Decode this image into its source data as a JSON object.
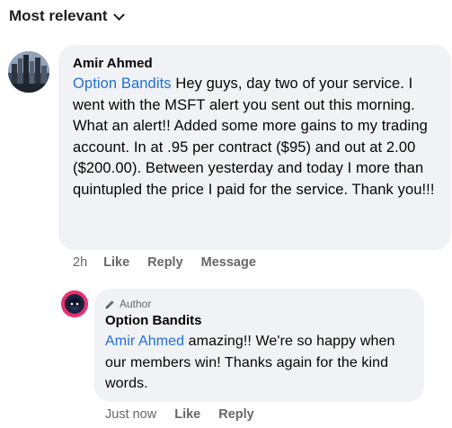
{
  "sort": {
    "label": "Most relevant",
    "icon": "chevron-down-icon"
  },
  "comments": [
    {
      "author": "Amir Ahmed",
      "mention": "Option Bandits",
      "text": " Hey guys, day two of your service.  I went with the MSFT alert you sent out this morning.  What an alert!! Added some more gains to my trading account.  In at .95 per contract ($95) and out at 2.00 ($200.00).  Between yesterday and today I more than quintupled the price I paid for the service. Thank you!!!",
      "time": "2h",
      "actions": [
        "Like",
        "Reply",
        "Message"
      ]
    },
    {
      "badge": "Author",
      "badge_icon": "pencil-icon",
      "author": "Option Bandits",
      "mention": "Amir Ahmed",
      "text": " amazing!! We're so happy when our members win! Thanks again for the kind words.",
      "time": "Just now",
      "actions": [
        "Like",
        "Reply"
      ]
    }
  ],
  "colors": {
    "mention": "#216fdb",
    "bubble": "#f0f2f5",
    "meta": "#65676b",
    "avatar_ring": "#e8336d"
  }
}
